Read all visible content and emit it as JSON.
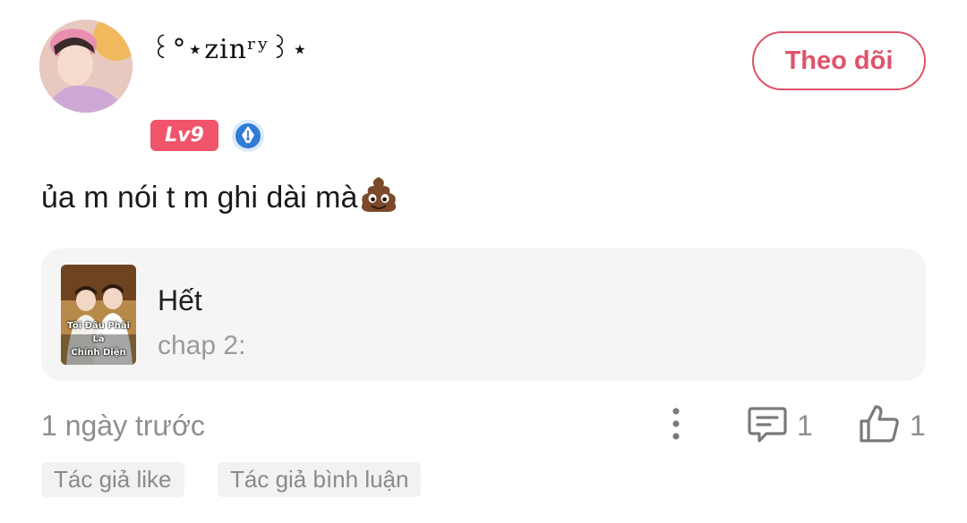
{
  "user": {
    "name": "꒰°⋆zinʳʸ꒱⋆",
    "level": "Lv9"
  },
  "follow_label": "Theo dõi",
  "comment": {
    "text": "ủa m nói t m ghi dài mà",
    "emoji": "💩"
  },
  "card": {
    "cover_title_line1": "Tôi Đâu Phải Là",
    "cover_title_line2": "Chính Diện",
    "title": "Hết",
    "subtitle": "chap 2:"
  },
  "footer": {
    "time": "1 ngày trước",
    "comment_count": "1",
    "like_count": "1"
  },
  "tags": [
    "Tác giả like",
    "Tác giả bình luận"
  ],
  "colors": {
    "accent": "#e0526a",
    "level_badge": "#f0556b",
    "muted_text": "#8e8e8e",
    "card_bg": "#f5f5f5"
  },
  "icons": {
    "more": "more-vertical-icon",
    "comment": "comment-icon",
    "like": "thumbs-up-icon",
    "verified": "pen-nib-badge-icon"
  }
}
